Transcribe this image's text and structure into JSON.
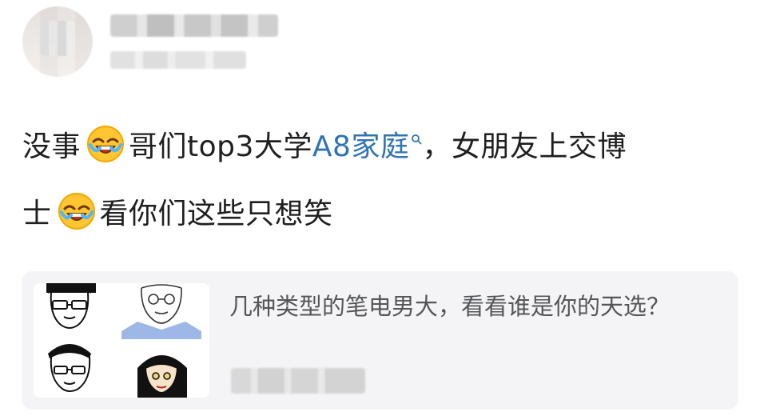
{
  "post": {
    "line1_prefix": "没事",
    "line1_mid": "哥们top3大学",
    "hashtag": "A8家庭",
    "line1_suffix": "，女朋友上交博",
    "line2_prefix": "士",
    "line2_suffix": "看你们这些只想笑",
    "emoji": "laughing-crying-emoji"
  },
  "card": {
    "title": "几种类型的笔电男大，看看谁是你的天选？"
  },
  "colors": {
    "hashtag": "#2f73b5",
    "card_bg": "#f4f4f6",
    "text": "#1f1f1f",
    "card_text": "#555659"
  }
}
